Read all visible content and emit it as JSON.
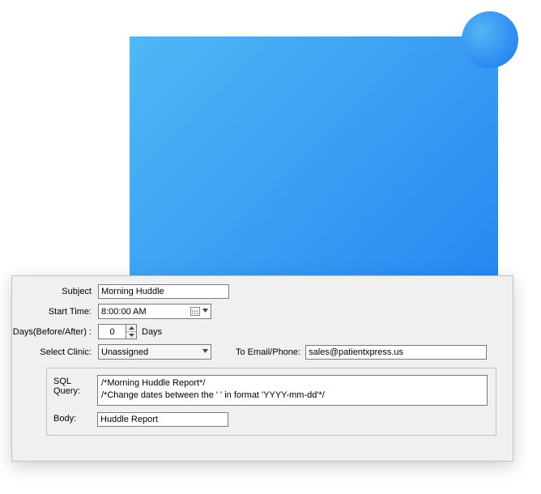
{
  "subject": {
    "label": "Subject",
    "value": "Morning Huddle"
  },
  "start_time": {
    "label": "Start Time:",
    "value": "8:00:00 AM"
  },
  "days": {
    "label": "Days(Before/After) :",
    "value": "0",
    "suffix": "Days"
  },
  "clinic": {
    "label": "Select Clinic:",
    "value": "Unassigned"
  },
  "to": {
    "label": "To Email/Phone:",
    "value": "sales@patientxpress.us"
  },
  "sql": {
    "label": "SQL Query:",
    "line1": "/*Morning Huddle Report*/",
    "line2": "/*Change dates between the ' ' in format 'YYYY-mm-dd'*/"
  },
  "body": {
    "label": "Body:",
    "value": "Huddle Report"
  }
}
